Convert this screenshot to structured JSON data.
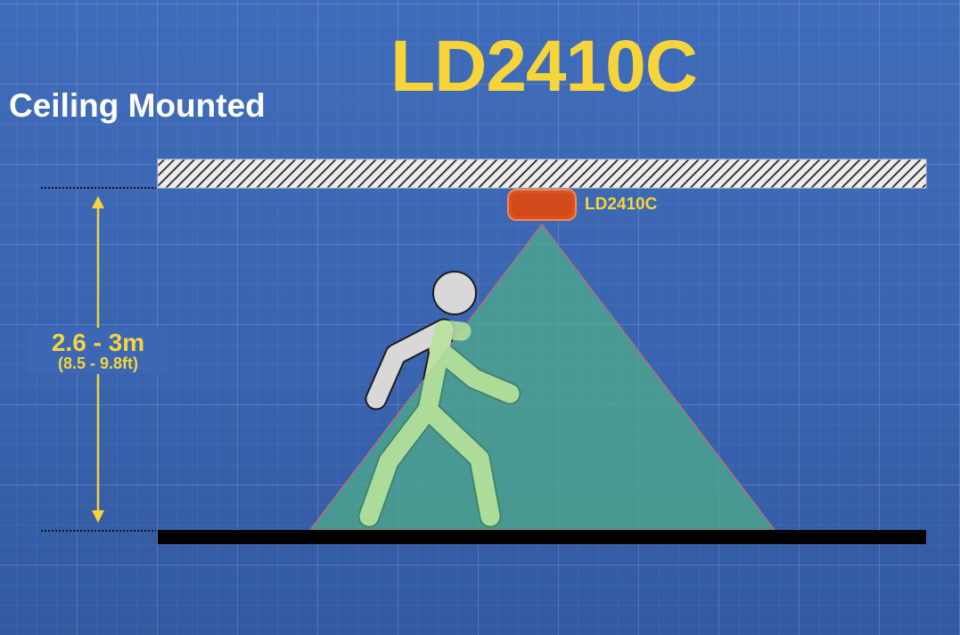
{
  "title": "LD2410C",
  "subtitle": "Ceiling Mounted",
  "sensor": {
    "label": "LD2410C",
    "color": "#e0501e"
  },
  "height": {
    "metric": "2.6 - 3m",
    "imperial": "(8.5 - 9.8ft)"
  },
  "colors": {
    "background": "#3c67b4",
    "accent": "#f7d43a",
    "detection_zone": "#4aa887",
    "ceiling": "#e6e6e6",
    "floor": "#000000",
    "person": "#d9d9d9"
  }
}
